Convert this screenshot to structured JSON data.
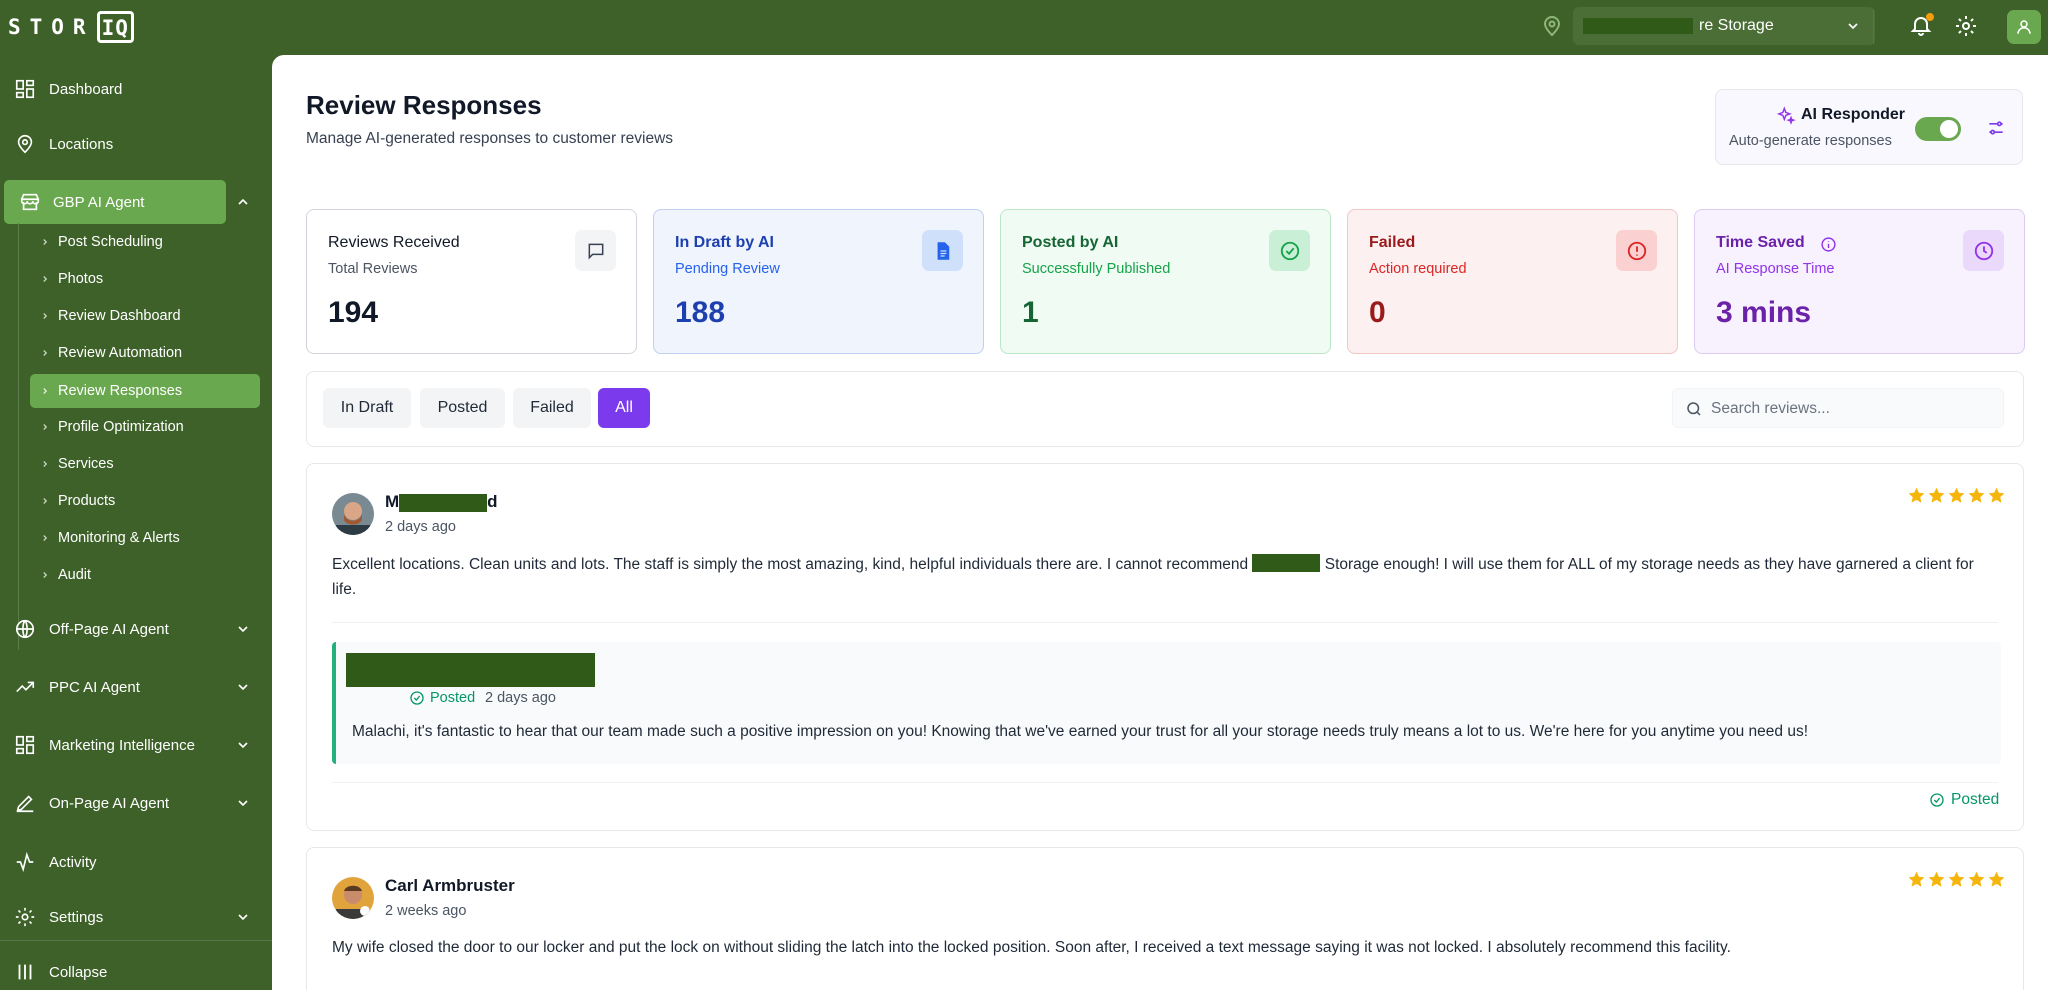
{
  "app": {
    "logo_main": "STOR",
    "logo_io": "IQ",
    "store_selector_suffix": "re Storage"
  },
  "sidebar": {
    "items": [
      {
        "label": "Dashboard",
        "icon": "grid-icon"
      },
      {
        "label": "Locations",
        "icon": "map-pin-icon"
      },
      {
        "label": "GBP AI Agent",
        "icon": "store-icon"
      },
      {
        "label": "Off-Page AI Agent",
        "icon": "globe-icon"
      },
      {
        "label": "PPC AI Agent",
        "icon": "trending-up-icon"
      },
      {
        "label": "Marketing Intelligence",
        "icon": "grid-icon"
      },
      {
        "label": "On-Page AI Agent",
        "icon": "pencil-icon"
      },
      {
        "label": "Activity",
        "icon": "activity-icon"
      },
      {
        "label": "Settings",
        "icon": "gear-icon"
      },
      {
        "label": "Collapse",
        "icon": "bars-icon"
      }
    ],
    "sub_items": [
      "Post Scheduling",
      "Photos",
      "Review Dashboard",
      "Review Automation",
      "Review Responses",
      "Profile Optimization",
      "Services",
      "Products",
      "Monitoring & Alerts",
      "Audit"
    ]
  },
  "header": {
    "title": "Review Responses",
    "subtitle": "Manage AI-generated responses to customer reviews"
  },
  "ai_responder": {
    "title": "AI Responder",
    "subtitle": "Auto-generate responses",
    "enabled": true
  },
  "stats": [
    {
      "title": "Reviews Received",
      "subtitle": "Total Reviews",
      "value": "194",
      "color": "#111827",
      "sub_color": "#4b5563",
      "bg": "#ffffff",
      "border": "#d1d5db",
      "icon": "message-icon",
      "icon_bg": "#f3f4f6"
    },
    {
      "title": "In Draft by AI",
      "subtitle": "Pending Review",
      "value": "188",
      "color": "#1e40af",
      "sub_color": "#2563eb",
      "bg": "#eff4fd",
      "border": "#bfd0f0",
      "icon": "document-icon",
      "icon_bg": "#cfe0fb"
    },
    {
      "title": "Posted by AI",
      "subtitle": "Successfully Published",
      "value": "1",
      "color": "#166534",
      "sub_color": "#16a34a",
      "bg": "#effbf3",
      "border": "#bde6c9",
      "icon": "check-circle-icon",
      "icon_bg": "#c9f0d6"
    },
    {
      "title": "Failed",
      "subtitle": "Action required",
      "value": "0",
      "color": "#991b1b",
      "sub_color": "#dc2626",
      "bg": "#fdf0f0",
      "border": "#f3c5c5",
      "icon": "alert-circle-icon",
      "icon_bg": "#fbd0d0"
    },
    {
      "title": "Time Saved",
      "subtitle": "AI Response Time",
      "value": "3 mins",
      "color": "#6b21a8",
      "sub_color": "#9333ea",
      "bg": "#f7f2fd",
      "border": "#dccbf3",
      "icon": "clock-icon",
      "icon_bg": "#ead9fb"
    }
  ],
  "filters": {
    "tabs": [
      "In Draft",
      "Posted",
      "Failed",
      "All"
    ],
    "active": "All",
    "search_placeholder": "Search reviews..."
  },
  "reviews": [
    {
      "name_start": "M",
      "name_end": "d",
      "time": "2 days ago",
      "rating": 5,
      "text_before": "Excellent locations. Clean units and lots. The staff is simply the most amazing, kind, helpful individuals there are. I cannot recommend",
      "text_after": "Storage enough! I will use them for ALL of my storage needs as they have garnered a client for life.",
      "response": {
        "status": "Posted",
        "time": "2 days ago",
        "text": "Malachi, it's fantastic to hear that our team made such a positive impression on you! Knowing that we've earned your trust for all your storage needs truly means a lot to us. We're here for you anytime you need us!"
      },
      "footer_status": "Posted"
    },
    {
      "name": "Carl Armbruster",
      "time": "2 weeks ago",
      "rating": 5,
      "text": "My wife closed the door to our locker and put the lock on without sliding the latch into the locked position. Soon after, I received a text message saying it was not locked. I absolutely recommend this facility."
    }
  ]
}
